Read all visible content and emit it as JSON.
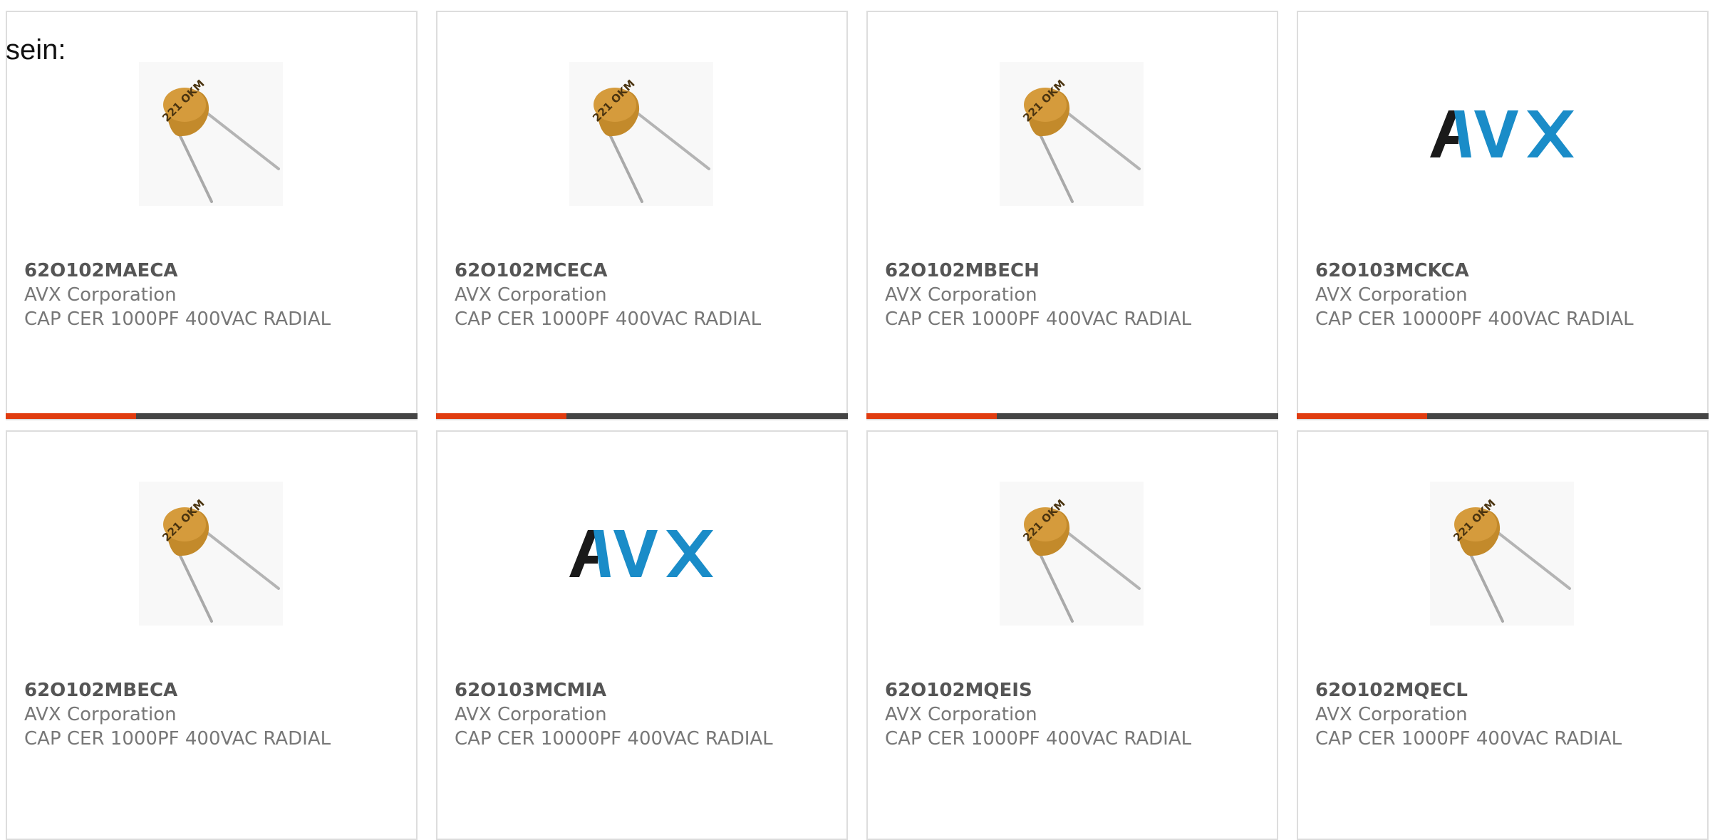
{
  "intro_text": "sein:",
  "colors": {
    "accent": "#e03c10",
    "bar_track": "#444444",
    "card_border": "#dddddd",
    "part_number": "#555555",
    "meta_text": "#777777",
    "avx_blue": "#1a8cc8",
    "avx_black": "#1a1a1a"
  },
  "products": [
    {
      "part_number": "62O102MAECA",
      "manufacturer": "AVX Corporation",
      "description": "CAP CER 1000PF 400VAC RADIAL",
      "image": "ceramic-capacitor-icon",
      "image_text": "221 OKM",
      "has_bar": true
    },
    {
      "part_number": "62O102MCECA",
      "manufacturer": "AVX Corporation",
      "description": "CAP CER 1000PF 400VAC RADIAL",
      "image": "ceramic-capacitor-icon",
      "image_text": "221 OKM",
      "has_bar": true
    },
    {
      "part_number": "62O102MBECH",
      "manufacturer": "AVX Corporation",
      "description": "CAP CER 1000PF 400VAC RADIAL",
      "image": "ceramic-capacitor-icon",
      "image_text": "221 OKM",
      "has_bar": true
    },
    {
      "part_number": "62O103MCKCA",
      "manufacturer": "AVX Corporation",
      "description": "CAP CER 10000PF 400VAC RADIAL",
      "image": "avx-logo",
      "image_text": "AVX",
      "has_bar": true
    },
    {
      "part_number": "62O102MBECA",
      "manufacturer": "AVX Corporation",
      "description": "CAP CER 1000PF 400VAC RADIAL",
      "image": "ceramic-capacitor-icon",
      "image_text": "221 OKM",
      "has_bar": false
    },
    {
      "part_number": "62O103MCMIA",
      "manufacturer": "AVX Corporation",
      "description": "CAP CER 10000PF 400VAC RADIAL",
      "image": "avx-logo",
      "image_text": "AVX",
      "has_bar": false
    },
    {
      "part_number": "62O102MQEIS",
      "manufacturer": "AVX Corporation",
      "description": "CAP CER 1000PF 400VAC RADIAL",
      "image": "ceramic-capacitor-icon",
      "image_text": "221 OKM",
      "has_bar": false
    },
    {
      "part_number": "62O102MQECL",
      "manufacturer": "AVX Corporation",
      "description": "CAP CER 1000PF 400VAC RADIAL",
      "image": "ceramic-capacitor-icon",
      "image_text": "221 OKM",
      "has_bar": false
    }
  ]
}
